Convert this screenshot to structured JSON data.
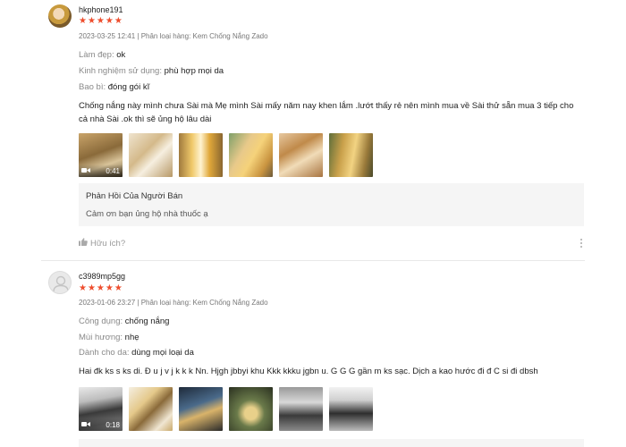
{
  "reviews": [
    {
      "username": "hkphone191",
      "stars": "★★★★★",
      "meta": "2023-03-25 12:41 | Phân loại hàng: Kem Chống Nắng Zado",
      "attributes": [
        {
          "key": "Làm đẹp: ",
          "value": "ok"
        },
        {
          "key": "Kinh nghiệm sử dụng: ",
          "value": "phù hợp mọi da"
        },
        {
          "key": "Bao bì: ",
          "value": "đóng gói kĩ"
        }
      ],
      "comment": "Chống nắng này mình chưa Sài mà Mẹ mình Sài mấy năm nay khen lắm .lướt thấy rẻ nên mình mua về Sài thử sẵn mua 3 tiếp cho cả nhà Sài .ok thì sẽ ủng hộ lâu dài",
      "video_duration": "0:41",
      "seller_reply_title": "Phản Hồi Của Người Bán",
      "seller_reply": "Cảm ơn bạn ủng hộ nhà thuốc ạ",
      "helpful_label": "Hữu ích?"
    },
    {
      "username": "c3989mp5gg",
      "stars": "★★★★★",
      "meta": "2023-01-06 23:27 | Phân loại hàng: Kem Chống Nắng Zado",
      "attributes": [
        {
          "key": "Công dụng: ",
          "value": "chống nắng"
        },
        {
          "key": "Mùi hương: ",
          "value": "nhẹ"
        },
        {
          "key": "Dành cho da: ",
          "value": "dùng mọi loại da"
        }
      ],
      "comment": "Hai đk ks s ks di. Đ u j v j k k k Nn. Hjgh jbbyi khu Kkk kkku jgbn u. G G G gần m ks sạc. Dịch a kao hước đi đ C si đi dbsh",
      "video_duration": "0:18"
    }
  ],
  "colors": {
    "star": "#ee4d2d",
    "reply_bg": "#f5f5f5",
    "divider": "#e8e8e8"
  },
  "icons": {
    "video": "video-camera-icon",
    "helpful": "thumbs-up-icon",
    "more": "more-vertical-icon",
    "avatar_default": "user-icon"
  }
}
